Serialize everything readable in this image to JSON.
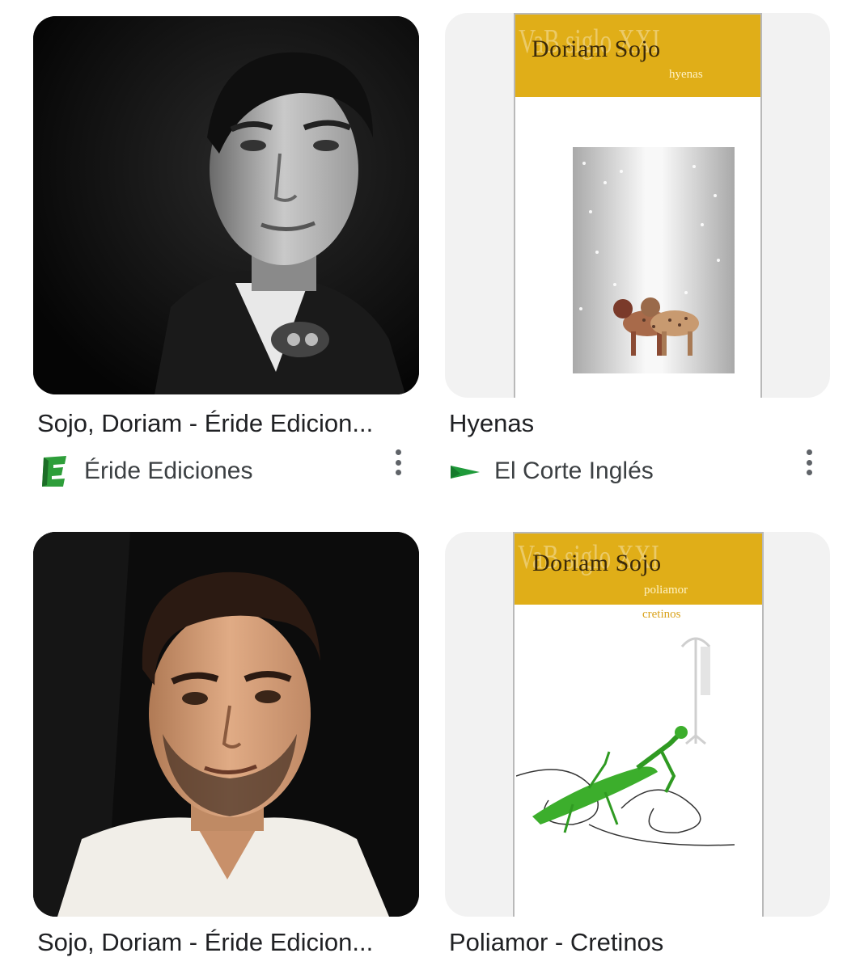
{
  "results": [
    {
      "title": "Sojo, Doriam - Éride Edicion...",
      "source": "Éride Ediciones",
      "source_icon": "eride-logo-icon",
      "image": "black-and-white portrait photo"
    },
    {
      "title": "Hyenas",
      "source": "El Corte Inglés",
      "source_icon": "el-corte-ingles-logo-icon",
      "cover": {
        "author": "Doriam Sojo",
        "subtitle": "hyenas",
        "watermark": "VaB siglo XXI"
      }
    },
    {
      "title": "Sojo, Doriam - Éride Edicion...",
      "image": "color portrait photo"
    },
    {
      "title": "Poliamor - Cretinos",
      "cover": {
        "author": "Doriam Sojo",
        "subtitle": "poliamor",
        "subtitle2": "cretinos",
        "watermark": "VaB siglo XXI"
      }
    }
  ],
  "colors": {
    "cover_band": "#e0ae18",
    "eride_green": "#2e9e3a",
    "eci_green": "#1f9a3a",
    "text_primary": "#202124",
    "text_secondary": "#3c4043"
  }
}
